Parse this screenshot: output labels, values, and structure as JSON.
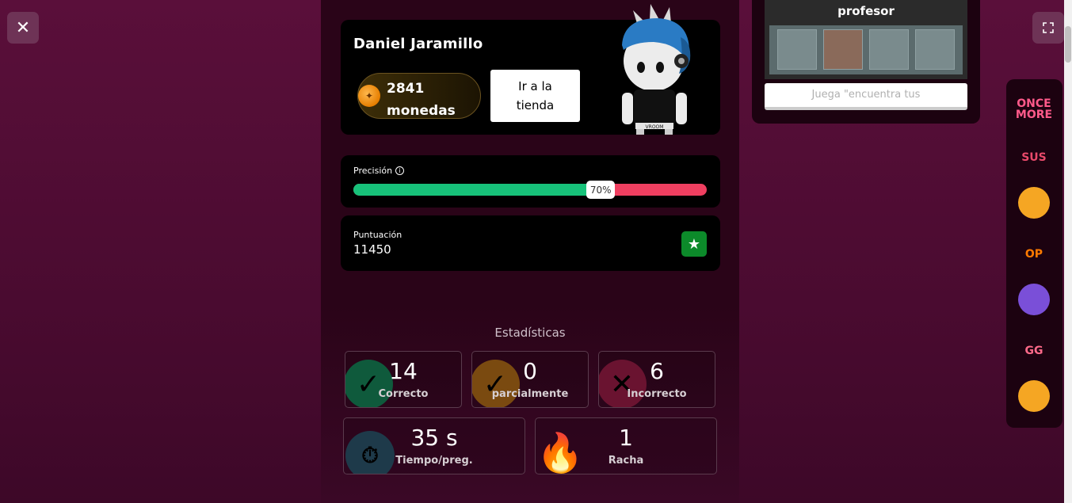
{
  "window": {
    "close_label": "✕",
    "fullscreen_icon": "fullscreen-icon"
  },
  "profile": {
    "name": "Daniel Jaramillo",
    "coins": "2841",
    "coins_unit": "monedas",
    "shop_line1": "Ir a la",
    "shop_line2": "tienda",
    "avatar_badge": "VROOM"
  },
  "precision": {
    "label": "Precisión",
    "percent": 70,
    "percent_label": "70%",
    "correct_color": "#17c27a",
    "incorrect_color": "#ef3f60"
  },
  "score": {
    "label": "Puntuación",
    "value": "11450"
  },
  "stats": {
    "title": "Estadísticas",
    "correct": {
      "value": "14",
      "label": "Correcto"
    },
    "partial": {
      "value": "0",
      "label": "parcialmente"
    },
    "incorrect": {
      "value": "6",
      "label": "Incorrecto"
    },
    "time": {
      "value": "35 s",
      "label": "Tiempo/preg."
    },
    "streak": {
      "value": "1",
      "label": "Racha"
    }
  },
  "right_panel": {
    "title": "profesor",
    "play_button": "Juega \"encuentra tus"
  },
  "stickers": [
    {
      "name": "once-more-sticker",
      "label": "ONCE MORE",
      "color": "#ff5a8a"
    },
    {
      "name": "sus-sticker",
      "label": "SUS",
      "color": "#e94a6b"
    },
    {
      "name": "mind-blown-sticker",
      "label": "",
      "color": "#f5a623"
    },
    {
      "name": "op-sticker",
      "label": "OP",
      "color": "#ff7a00"
    },
    {
      "name": "impostor-sticker",
      "label": "",
      "color": "#7a4fd8"
    },
    {
      "name": "gg-sticker",
      "label": "GG",
      "color": "#ff6a8a"
    },
    {
      "name": "cool-face-sticker",
      "label": "",
      "color": "#f5a623"
    }
  ]
}
